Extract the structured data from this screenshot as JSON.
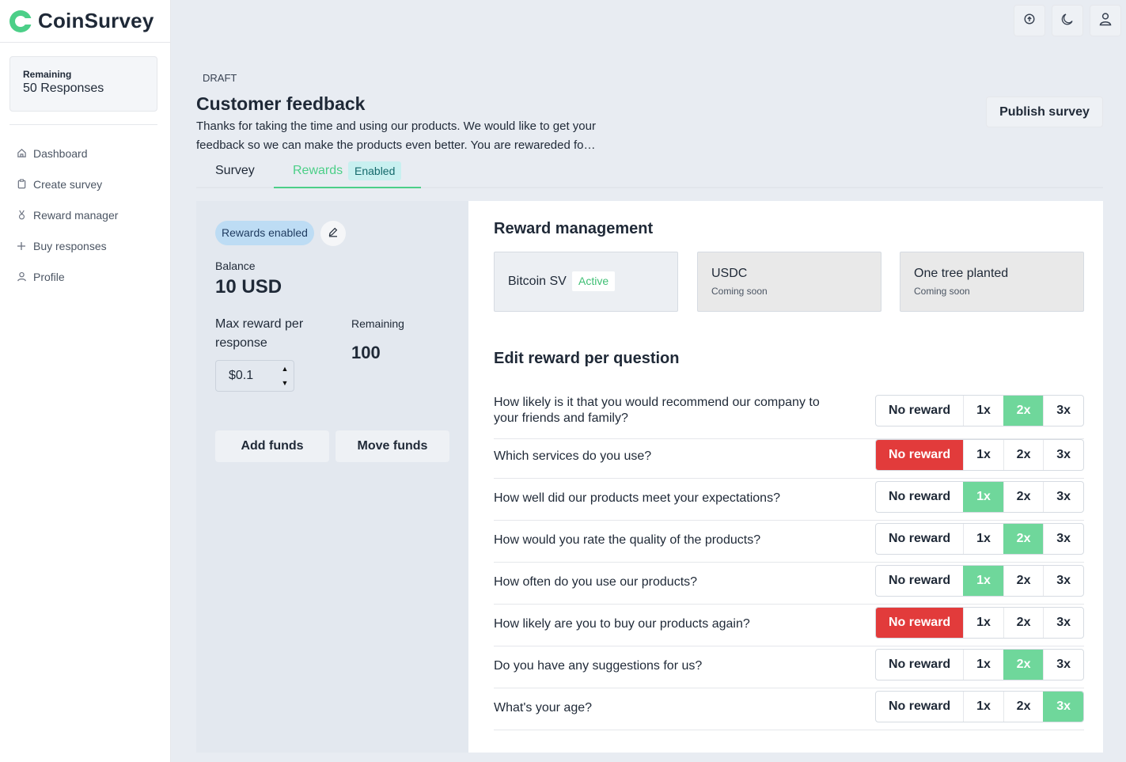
{
  "app": {
    "name": "CoinSurvey"
  },
  "sidebar": {
    "remaining_label": "Remaining",
    "remaining_value": "50 Responses",
    "items": [
      {
        "label": "Dashboard",
        "icon": "home-icon"
      },
      {
        "label": "Create survey",
        "icon": "clipboard-icon"
      },
      {
        "label": "Reward manager",
        "icon": "medal-icon"
      },
      {
        "label": "Buy responses",
        "icon": "plus-icon"
      },
      {
        "label": "Profile",
        "icon": "user-icon"
      }
    ]
  },
  "topbar": {
    "icons": [
      "upload-icon",
      "moon-icon",
      "user-icon"
    ]
  },
  "survey": {
    "status": "DRAFT",
    "title": "Customer feedback",
    "description": "Thanks for taking the time and using our products. We would like to get your feedback so we can make the products even better. You are rewareded fo…",
    "publish_label": "Publish survey"
  },
  "tabs": {
    "survey": "Survey",
    "rewards": "Rewards",
    "rewards_badge": "Enabled"
  },
  "rewards": {
    "status_pill": "Rewards enabled",
    "balance_label": "Balance",
    "balance_value": "10 USD",
    "max_label": "Max reward per response",
    "max_value": "$0.1",
    "remaining_label": "Remaining",
    "remaining_value": "100",
    "add_funds": "Add funds",
    "move_funds": "Move funds"
  },
  "management": {
    "title": "Reward management",
    "options": [
      {
        "name": "Bitcoin SV",
        "tag": "Active"
      },
      {
        "name": "USDC",
        "sub": "Coming soon"
      },
      {
        "name": "One tree planted",
        "sub": "Coming soon"
      }
    ]
  },
  "per_question": {
    "title": "Edit reward per question",
    "choices": [
      "No reward",
      "1x",
      "2x",
      "3x"
    ],
    "colors": {
      "selected_multiplier": "#6fd79b",
      "selected_no_reward": "#e23b3b"
    },
    "questions": [
      {
        "text": "How likely is it that you would recommend our company to your friends and family?",
        "selected": "2x"
      },
      {
        "text": "Which services do you use?",
        "selected": "No reward"
      },
      {
        "text": "How well did our products meet your expectations?",
        "selected": "1x"
      },
      {
        "text": "How would you rate the quality of the products?",
        "selected": "2x"
      },
      {
        "text": "How often do you use our products?",
        "selected": "1x"
      },
      {
        "text": "How likely are you to buy our products again?",
        "selected": "No reward"
      },
      {
        "text": "Do you have any suggestions for us?",
        "selected": "2x"
      },
      {
        "text": "What's your age?",
        "selected": "3x"
      }
    ]
  }
}
